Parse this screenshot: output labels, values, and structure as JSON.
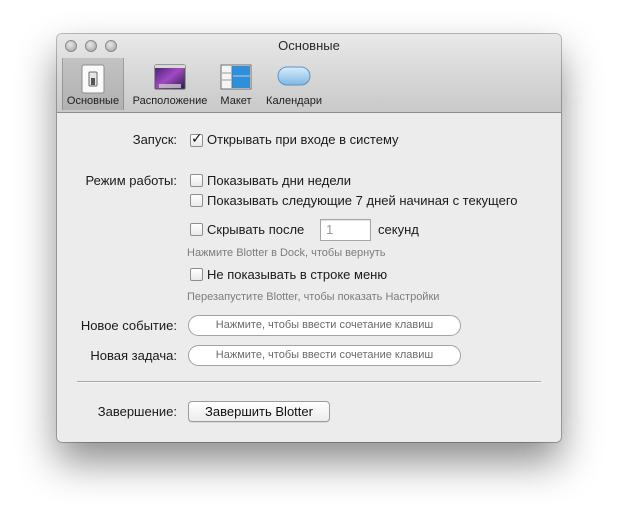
{
  "window": {
    "title": "Основные"
  },
  "toolbar": {
    "tabs": [
      {
        "label": "Основные",
        "icon": "switch-icon",
        "selected": true
      },
      {
        "label": "Расположение",
        "icon": "desktop-icon",
        "selected": false
      },
      {
        "label": "Макет",
        "icon": "layout-icon",
        "selected": false
      },
      {
        "label": "Календари",
        "icon": "calendar-pill-icon",
        "selected": false
      }
    ]
  },
  "launch": {
    "label": "Запуск:",
    "open_at_login": {
      "label": "Открывать при входе в систему",
      "checked": true
    }
  },
  "mode": {
    "label": "Режим работы:",
    "show_weekdays": {
      "label": "Показывать дни недели",
      "checked": false
    },
    "show_next_7": {
      "label": "Показывать следующие 7 дней начиная с текущего",
      "checked": false
    },
    "hide_after": {
      "label": "Скрывать после",
      "checked": false,
      "value": "1",
      "unit": "секунд"
    },
    "hide_hint": "Нажмите Blotter в Dock, чтобы вернуть",
    "hide_menubar": {
      "label": "Не показывать в строке меню",
      "checked": false
    },
    "menubar_hint": "Перезапустите Blotter, чтобы показать Настройки"
  },
  "shortcuts": {
    "new_event": {
      "label": "Новое событие:",
      "placeholder": "Нажмите, чтобы ввести сочетание клавиш"
    },
    "new_task": {
      "label": "Новая задача:",
      "placeholder": "Нажмите, чтобы ввести сочетание клавиш"
    }
  },
  "quit": {
    "label": "Завершение:",
    "button": "Завершить Blotter"
  }
}
